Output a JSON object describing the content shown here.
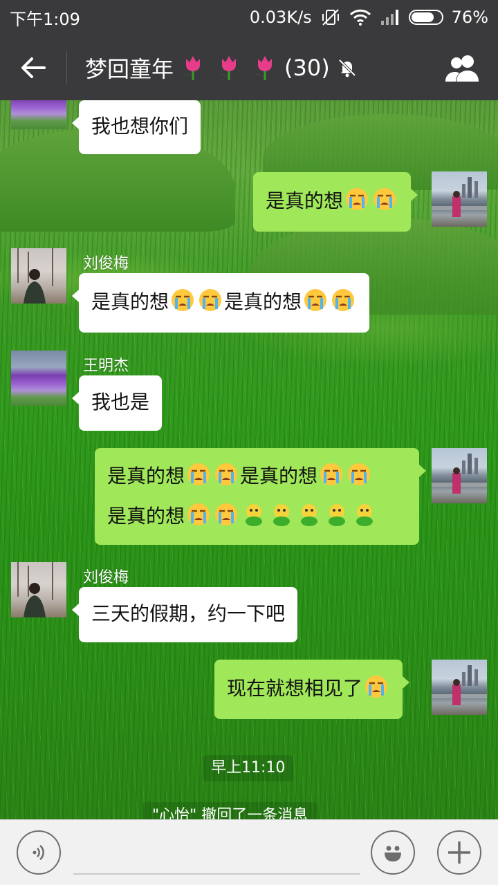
{
  "status_bar": {
    "time": "下午1:09",
    "network_speed": "0.03K/s",
    "battery": "76%",
    "battery_level": 0.76
  },
  "header": {
    "title": "梦回童年",
    "member_count": "(30)"
  },
  "messages": [
    {
      "side": "in",
      "avatar": "lavender",
      "sender": "",
      "text": "我也想你们"
    },
    {
      "side": "out",
      "avatar": "city",
      "text": "是真的想"
    },
    {
      "side": "in",
      "avatar": "tree",
      "sender": "刘俊梅",
      "text1": "是真的想",
      "text2": "是真的想"
    },
    {
      "side": "in",
      "avatar": "lavender",
      "sender": "王明杰",
      "text": "我也是"
    },
    {
      "side": "out",
      "avatar": "city",
      "text1": "是真的想",
      "text2": "是真的想",
      "text3": "是真的想"
    },
    {
      "side": "in",
      "avatar": "tree",
      "sender": "刘俊梅",
      "text": "三天的假期，约一下吧"
    },
    {
      "side": "out",
      "avatar": "city",
      "text": "现在就想相见了"
    }
  ],
  "timestamp": "早上11:10",
  "recall_notice": "\"心怡\" 撤回了一条消息",
  "colors": {
    "out_bubble": "#a0e759",
    "in_bubble": "#ffffff",
    "bar": "#3a3a3c"
  }
}
